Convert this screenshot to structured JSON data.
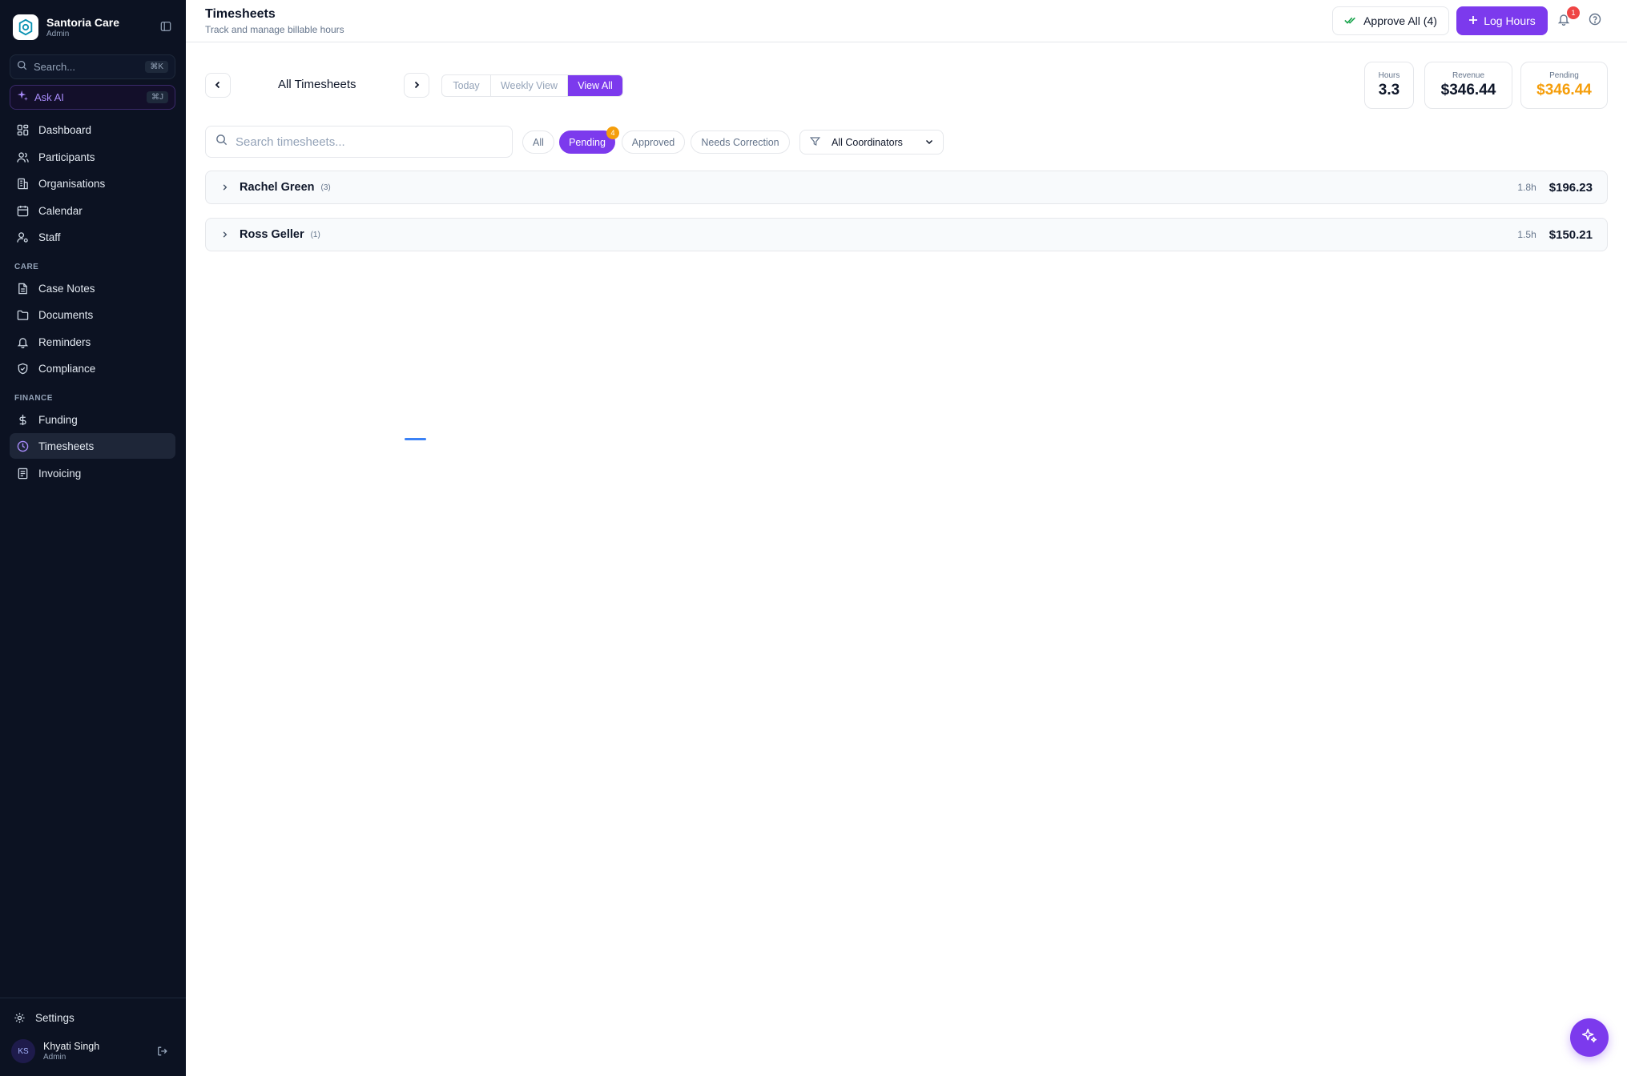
{
  "app": {
    "name": "Santoria Care",
    "role": "Admin"
  },
  "sidebar": {
    "search_placeholder": "Search...",
    "search_shortcut": "⌘K",
    "ask_ai_label": "Ask AI",
    "ask_ai_shortcut": "⌘J",
    "main_items": [
      {
        "label": "Dashboard",
        "icon": "grid-icon"
      },
      {
        "label": "Participants",
        "icon": "users-icon"
      },
      {
        "label": "Organisations",
        "icon": "building-icon"
      },
      {
        "label": "Calendar",
        "icon": "calendar-icon"
      },
      {
        "label": "Staff",
        "icon": "user-cog-icon"
      }
    ],
    "care_section": "CARE",
    "care_items": [
      {
        "label": "Case Notes",
        "icon": "file-text-icon"
      },
      {
        "label": "Documents",
        "icon": "folder-icon"
      },
      {
        "label": "Reminders",
        "icon": "bell-icon"
      },
      {
        "label": "Compliance",
        "icon": "shield-icon"
      }
    ],
    "finance_section": "FINANCE",
    "finance_items": [
      {
        "label": "Funding",
        "icon": "dollar-icon"
      },
      {
        "label": "Timesheets",
        "icon": "clock-icon",
        "active": true
      },
      {
        "label": "Invoicing",
        "icon": "receipt-icon"
      }
    ],
    "settings_label": "Settings",
    "user": {
      "initials": "KS",
      "name": "Khyati Singh",
      "role": "Admin"
    }
  },
  "header": {
    "title": "Timesheets",
    "subtitle": "Track and manage billable hours",
    "approve_all_label": "Approve All (4)",
    "log_hours_label": "Log Hours",
    "notification_count": "1"
  },
  "toolbar": {
    "period_label": "All Timesheets",
    "views": [
      "Today",
      "Weekly View",
      "View All"
    ],
    "active_view": "View All"
  },
  "stats": {
    "hours_label": "Hours",
    "hours_value": "3.3",
    "revenue_label": "Revenue",
    "revenue_value": "$346.44",
    "pending_label": "Pending",
    "pending_value": "$346.44"
  },
  "filters": {
    "search_placeholder": "Search timesheets...",
    "statuses": [
      "All",
      "Pending",
      "Approved",
      "Needs Correction"
    ],
    "active_status": "Pending",
    "pending_count": "4",
    "coordinator_label": "All Coordinators"
  },
  "groups": [
    {
      "name": "Rachel Green",
      "count": "(3)",
      "hours": "1.8h",
      "amount": "$196.23"
    },
    {
      "name": "Ross Geller",
      "count": "(1)",
      "hours": "1.5h",
      "amount": "$150.21"
    }
  ],
  "colors": {
    "accent": "#7c3aed",
    "pending": "#f59e0b",
    "sidebar_bg": "#0c1222",
    "badge_red": "#ef4444"
  }
}
